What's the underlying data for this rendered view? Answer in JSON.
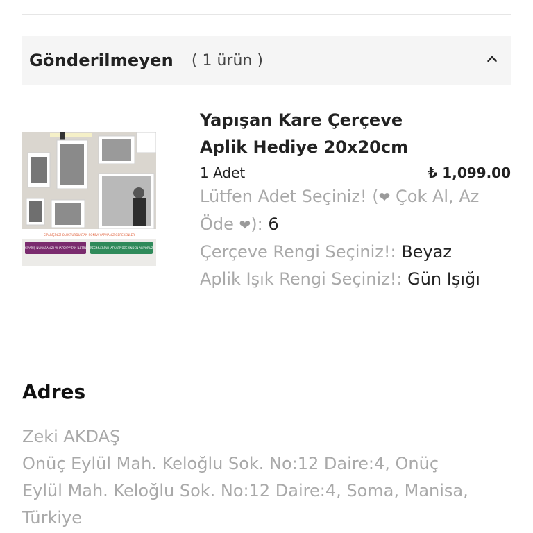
{
  "section": {
    "title": "Gönderilmeyen",
    "count": "( 1 ürün )"
  },
  "product": {
    "title_line1": "Yapışan Kare Çerçeve",
    "title_line2": "Aplik Hediye 20x20cm",
    "quantity": "1 Adet",
    "price": "₺ 1,099.00",
    "image_texts": {
      "banner": "SİPARİŞİNİZİ OLUŞTURDUKTAN SONRA YAPMANIZ GEREKENLER",
      "left_badge": "SİPARİŞ NUMARANIZI WHATSAPP'TAN İLETİN",
      "right_badge": "RESİMLERİ WHATSAPP ÜZERİNDEN ALIYORUZ"
    },
    "options": {
      "adet_label_a": "Lütfen Adet Seçiniz! (",
      "adet_label_b": " Çok Al, Az",
      "adet_label_c": "Öde ",
      "adet_label_d": "):",
      "adet_value": "6",
      "frame_label": "Çerçeve Rengi Seçiniz!:",
      "frame_value": "Beyaz",
      "light_label": "Aplik Işık Rengi Seçiniz!:",
      "light_value": "Gün Işığı"
    }
  },
  "address": {
    "title": "Adres",
    "name": "Zeki AKDAŞ",
    "line1": "Onüç Eylül Mah. Keloğlu Sok. No:12 Daire:4, Onüç",
    "line2": "Eylül Mah. Keloğlu Sok. No:12 Daire:4, Soma, Manisa,",
    "line3": "Türkiye"
  },
  "icons": {
    "collapse": "chevron-up-icon",
    "heart": "heart-icon"
  }
}
